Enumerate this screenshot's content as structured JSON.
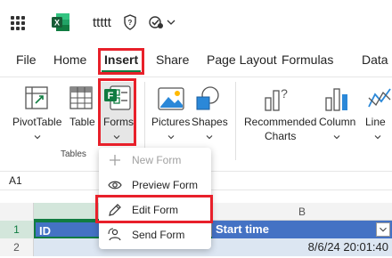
{
  "titlebar": {
    "doc_title": "ttttt"
  },
  "menu": {
    "file": "File",
    "home": "Home",
    "insert": "Insert",
    "share": "Share",
    "page_layout": "Page Layout",
    "formulas": "Formulas",
    "data": "Data"
  },
  "ribbon": {
    "pivottable": "PivotTable",
    "table": "Table",
    "forms": "Forms",
    "tables_group": "Tables",
    "pictures": "Pictures",
    "shapes": "Shapes",
    "recommended_1": "Recommended",
    "recommended_2": "Charts",
    "column": "Column",
    "line": "Line"
  },
  "namebox": {
    "value": "A1"
  },
  "grid": {
    "col_b": "B",
    "rows": [
      "1",
      "2"
    ],
    "a1": "ID",
    "b1": "Start time",
    "b2": "8/6/24 20:01:40"
  },
  "forms_menu": {
    "items": [
      {
        "label": "New Form",
        "icon": "plus-icon",
        "disabled": true
      },
      {
        "label": "Preview Form",
        "icon": "eye-icon",
        "disabled": false
      },
      {
        "label": "Edit Form",
        "icon": "pencil-icon",
        "disabled": false
      },
      {
        "label": "Send Form",
        "icon": "share-people-icon",
        "disabled": false
      }
    ]
  },
  "colors": {
    "accent": "#107c41",
    "highlight": "#e8202a",
    "table_header": "#4472c4",
    "table_band": "#dce6f2"
  }
}
